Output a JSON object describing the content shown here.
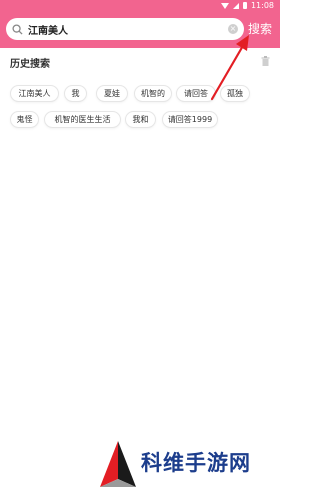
{
  "status": {
    "time": "11:08"
  },
  "search": {
    "value": "江南美人",
    "button_label": "搜索",
    "clear_glyph": "×"
  },
  "history": {
    "title": "历史搜索",
    "items": [
      "江南美人",
      "我",
      "夏娃",
      "机智的",
      "请回答",
      "孤独",
      "鬼怪",
      "机智的医生生活",
      "我和",
      "请回答1999"
    ]
  },
  "watermark": {
    "text": "科维手游网"
  },
  "colors": {
    "brand": "#f2648f",
    "arrow": "#e31e24",
    "watermark_blue": "#1c3d8c"
  }
}
